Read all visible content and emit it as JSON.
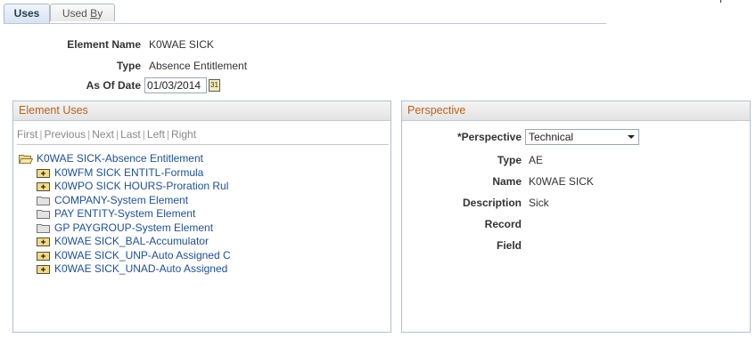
{
  "tabs": {
    "uses": "Uses",
    "used_by_prefix": "Used ",
    "used_by_underlined": "B",
    "used_by_suffix": "y"
  },
  "header": {
    "element_name_label": "Element Name",
    "element_name_value": "K0WAE SICK",
    "type_label": "Type",
    "type_value": "Absence Entitlement",
    "as_of_date_label": "As Of Date",
    "as_of_date_value": "01/03/2014"
  },
  "element_uses": {
    "title": "Element Uses",
    "nav": {
      "first": "First",
      "previous": "Previous",
      "next": "Next",
      "last": "Last",
      "left": "Left",
      "right": "Right"
    },
    "root": "K0WAE SICK-Absence Entitlement",
    "items": [
      {
        "label": "K0WFM SICK ENTITL-Formula",
        "icon": "folder-plus-icon"
      },
      {
        "label": "K0WPO SICK HOURS-Proration Rul",
        "icon": "folder-plus-icon"
      },
      {
        "label": "COMPANY-System Element",
        "icon": "folder-icon"
      },
      {
        "label": "PAY ENTITY-System Element",
        "icon": "folder-icon"
      },
      {
        "label": "GP PAYGROUP-System Element",
        "icon": "folder-icon"
      },
      {
        "label": "K0WAE SICK_BAL-Accumulator",
        "icon": "folder-plus-icon"
      },
      {
        "label": "K0WAE SICK_UNP-Auto Assigned C",
        "icon": "folder-plus-icon"
      },
      {
        "label": "K0WAE SICK_UNAD-Auto Assigned",
        "icon": "folder-plus-icon"
      }
    ]
  },
  "perspective": {
    "title": "Perspective",
    "perspective_label": "*Perspective",
    "perspective_value": "Technical",
    "type_label": "Type",
    "type_value": "AE",
    "name_label": "Name",
    "name_value": "K0WAE SICK",
    "description_label": "Description",
    "description_value": "Sick",
    "record_label": "Record",
    "field_label": "Field"
  },
  "colors": {
    "link": "#1f4f96",
    "group_title": "#c0601a",
    "folder": "#e8c860"
  }
}
